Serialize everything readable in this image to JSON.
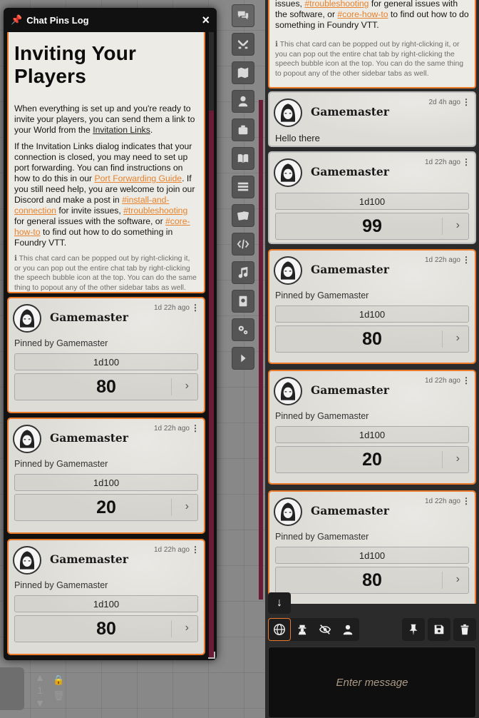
{
  "popout": {
    "title": "Chat Pins Log",
    "close_label": "×"
  },
  "journal": {
    "heading": "Inviting Your Players",
    "p1_a": "When everything is set up and you're ready to invite your players, you can send them a link to your World from the ",
    "p1_link": "Invitation Links",
    "p1_b": ".",
    "p2_a": "If the Invitation Links dialog indicates that your connection is closed, you may need to set up port forwarding. You can find instructions on how to do this in our ",
    "p2_link1": "Port Forwarding Guide",
    "p2_b": ". If you still need help, you are welcome to join our Discord and make a post in ",
    "p2_link2": "#install-and-connection",
    "p2_c": " for invite issues, ",
    "p2_link3": "#troubleshooting",
    "p2_d": " for general issues with the software, or ",
    "p2_link4": "#core-how-to",
    "p2_e": " to find out how to do something in Foundry VTT.",
    "note": "This chat card can be popped out by right-clicking it, or you can pop out the entire chat tab by right-clicking the speech bubble icon at the top. You can do the same thing to popout any of the other sidebar tabs as well."
  },
  "journal_top": {
    "t_a": "issues, ",
    "t_link1": "#troubleshooting",
    "t_b": " for general issues with the software, or ",
    "t_link2": "#core-how-to",
    "t_c": " to find out how to do something in Foundry VTT.",
    "note": "This chat card can be popped out by right-clicking it, or you can pop out the entire chat tab by right-clicking the speech bubble icon at the top. You can do the same thing to popout any of the other sidebar tabs as well."
  },
  "pins_log_messages": [
    {
      "sender": "Gamemaster",
      "timestamp": "1d 22h ago",
      "pinned_by": "Pinned by Gamemaster",
      "formula": "1d100",
      "total": "80"
    },
    {
      "sender": "Gamemaster",
      "timestamp": "1d 22h ago",
      "pinned_by": "Pinned by Gamemaster",
      "formula": "1d100",
      "total": "20"
    },
    {
      "sender": "Gamemaster",
      "timestamp": "1d 22h ago",
      "pinned_by": "Pinned by Gamemaster",
      "formula": "1d100",
      "total": "80"
    }
  ],
  "chat_messages": [
    {
      "sender": "Gamemaster",
      "timestamp": "2d 4h ago",
      "text": "Hello there"
    },
    {
      "sender": "Gamemaster",
      "timestamp": "1d 22h ago",
      "formula": "1d100",
      "total": "99"
    },
    {
      "sender": "Gamemaster",
      "timestamp": "1d 22h ago",
      "pinned_by": "Pinned by Gamemaster",
      "formula": "1d100",
      "total": "80"
    },
    {
      "sender": "Gamemaster",
      "timestamp": "1d 22h ago",
      "pinned_by": "Pinned by Gamemaster",
      "formula": "1d100",
      "total": "20"
    },
    {
      "sender": "Gamemaster",
      "timestamp": "1d 22h ago",
      "pinned_by": "Pinned by Gamemaster",
      "formula": "1d100",
      "total": "80"
    }
  ],
  "sidebar_tabs": [
    "chat-icon",
    "combat-icon",
    "scenes-icon",
    "actors-icon",
    "items-icon",
    "journal-icon",
    "tables-icon",
    "cards-icon",
    "macros-icon",
    "playlists-icon",
    "compendium-icon",
    "settings-icon",
    "collapse-icon"
  ],
  "chat_input": {
    "placeholder": "Enter message"
  },
  "token_controls": {
    "elevation": "1"
  },
  "colors": {
    "accent": "#ea7a2a",
    "scrollbar": "#6b1b35",
    "card": "#dedcd6"
  }
}
